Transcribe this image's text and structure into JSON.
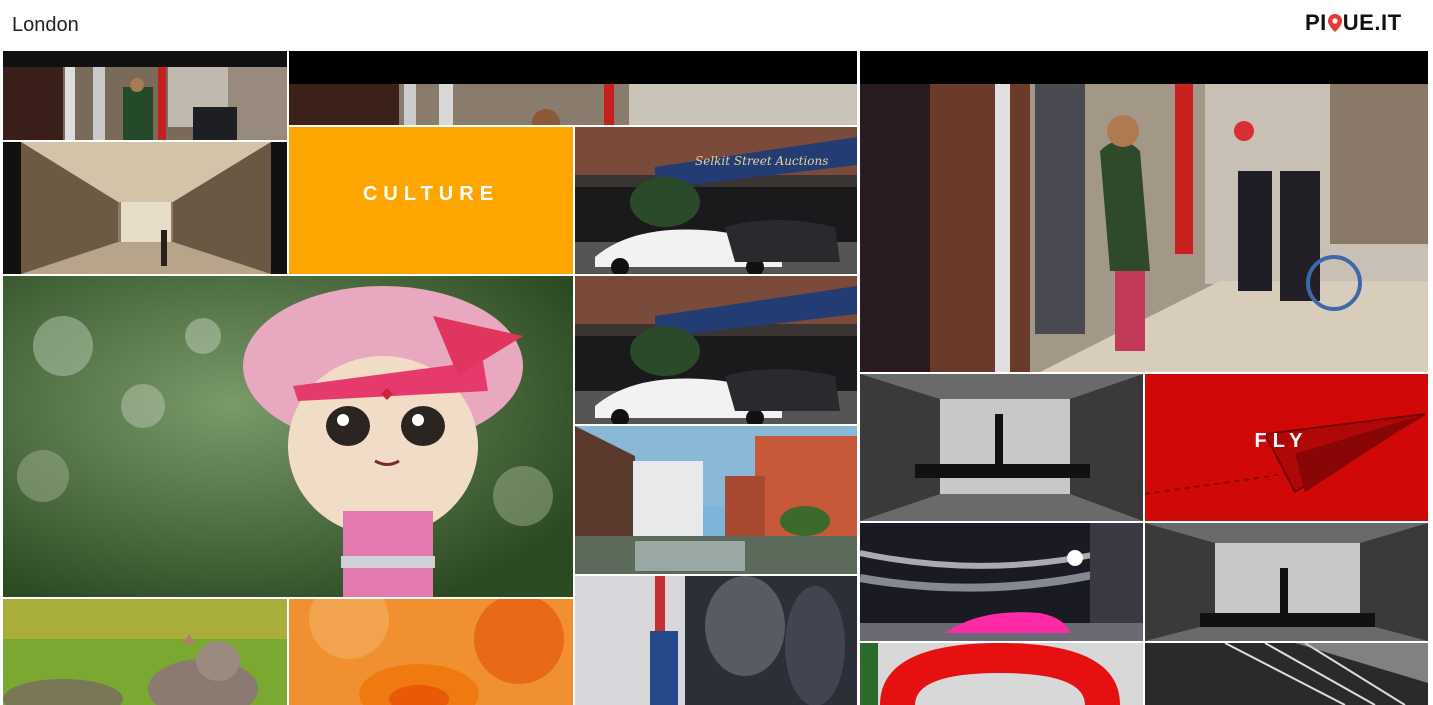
{
  "header": {
    "title": "London",
    "logo_left": "PI",
    "logo_right": "UE.IT",
    "logo_pin_color": "#e63a3a"
  },
  "tiles": {
    "culture": "CULTURE",
    "fly": "FLY"
  },
  "signs": {
    "shop_sign": "Selkit Street Auctions"
  },
  "colors": {
    "culture_bg": "#ffa500",
    "fly_bg": "#d00808"
  }
}
